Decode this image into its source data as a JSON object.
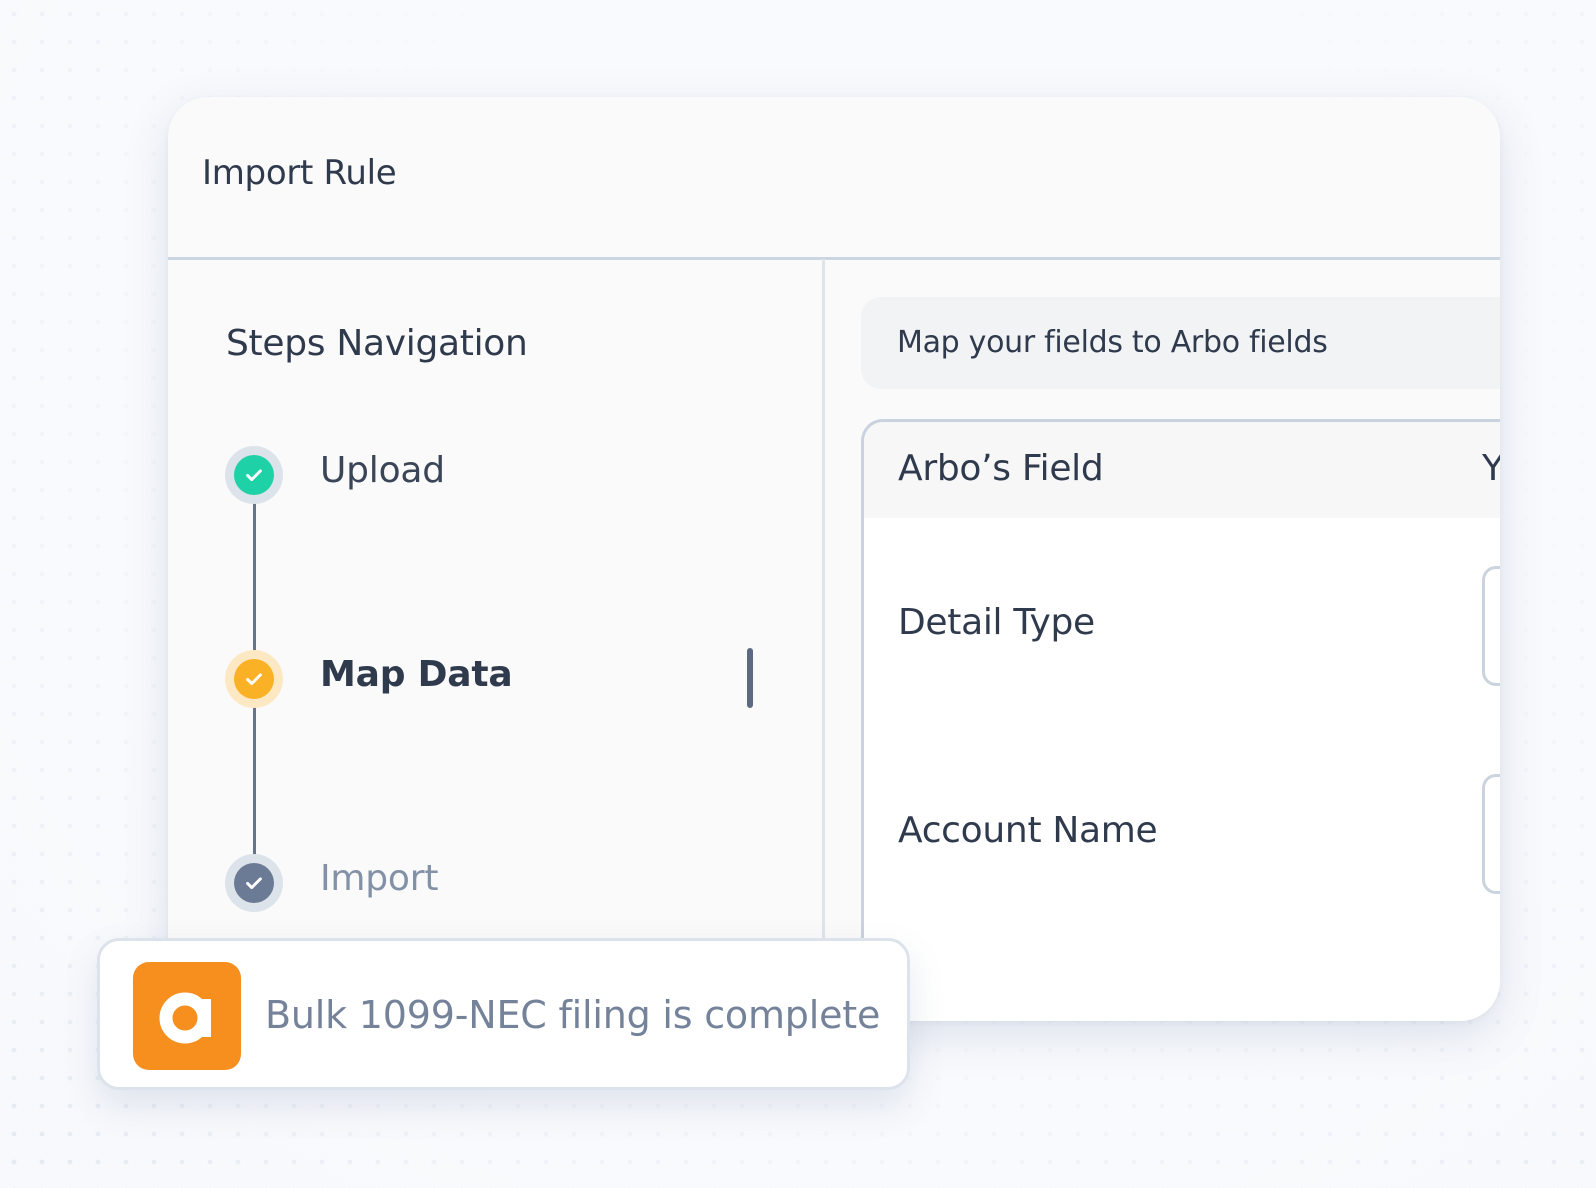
{
  "window": {
    "title": "Import Rule"
  },
  "steps": {
    "title": "Steps Navigation",
    "items": [
      {
        "label": "Upload",
        "status": "complete",
        "color": "#1fd1a6"
      },
      {
        "label": "Map Data",
        "status": "active",
        "color": "#fbb125"
      },
      {
        "label": "Import",
        "status": "pending",
        "color": "#6b7b95"
      }
    ]
  },
  "mapping": {
    "banner": "Map your fields to Arbo fields",
    "columns": [
      "Arbo’s Field",
      "Y"
    ],
    "rows": [
      {
        "label": "Detail Type"
      },
      {
        "label": "Account Name"
      }
    ]
  },
  "toast": {
    "logo_letter": "a",
    "logo_color": "#f68f1e",
    "message": "Bulk 1099-NEC filing is complete"
  }
}
